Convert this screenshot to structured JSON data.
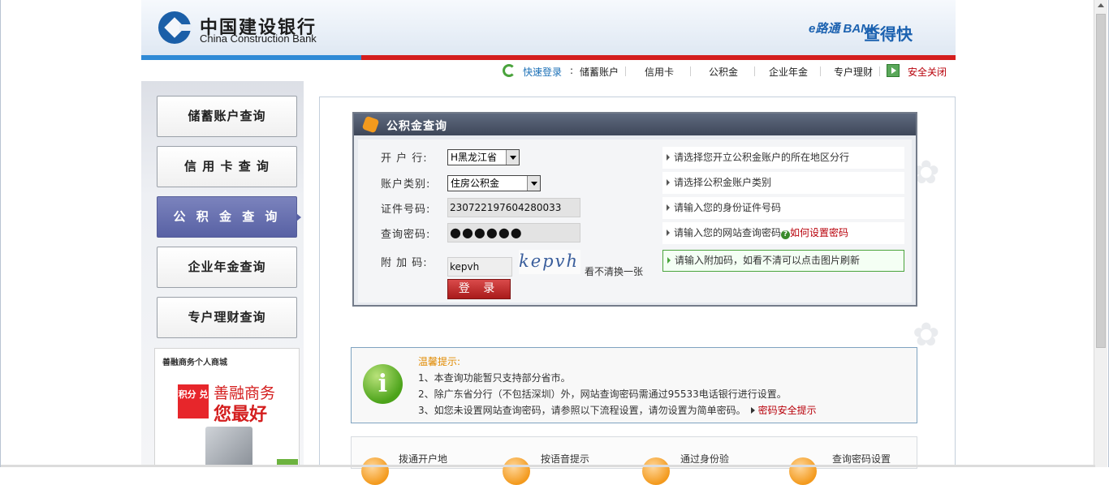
{
  "header": {
    "logo_cn": "中国建设银行",
    "logo_en": "China Construction Bank",
    "ebank": "e路通 BANK",
    "ebank_cn": "查得快"
  },
  "topnav": {
    "quick_login": "快速登录",
    "colon": ":",
    "items": [
      "储蓄账户",
      "信用卡",
      "公积金",
      "企业年金",
      "专户理财"
    ],
    "safe_exit": "安全关闭"
  },
  "sidebar": {
    "items": [
      {
        "label": "储蓄账户查询"
      },
      {
        "label": "信 用 卡 查 询"
      },
      {
        "label": "公 积 金 查 询"
      },
      {
        "label": "企业年金查询"
      },
      {
        "label": "专户理财查询"
      }
    ],
    "ad": {
      "top": "善融商务个人商城",
      "badge": "积分 兑",
      "line1": "善融商务",
      "line2": "您最好"
    }
  },
  "panel": {
    "title": "公积金查询",
    "labels": {
      "branch": "开 户 行:",
      "account_type": "账户类别:",
      "id_no": "证件号码:",
      "password": "查询密码:",
      "captcha": "附 加 码:"
    },
    "values": {
      "branch": "H黑龙江省",
      "account_type": "住房公积金",
      "id_no": "230722197604280033",
      "password": "●●●●●●",
      "captcha": "kepvh",
      "captcha_image": "kepvh"
    },
    "captcha_refresh": "看不清换一张",
    "login": "登 录",
    "hints": [
      "请选择您开立公积金账户的所在地区分行",
      "请选择公积金账户类别",
      "请输入您的身份证件号码",
      "请输入您的网站查询密码",
      "请输入附加码，如看不清可以点击图片刷新"
    ],
    "password_help": "如何设置密码"
  },
  "tips": {
    "title": "温馨提示:",
    "lines": [
      "1、本查询功能暂只支持部分省市。",
      "2、除广东省分行（不包括深圳）外，网站查询密码需通过95533电话银行进行设置。",
      "3、如您未设置网站查询密码，请参照以下流程设置，请勿设置为简单密码。"
    ],
    "link": "密码安全提示"
  },
  "steps": [
    "拨通开户地",
    "按语音提示",
    "通过身份验",
    "查询密码设置"
  ]
}
